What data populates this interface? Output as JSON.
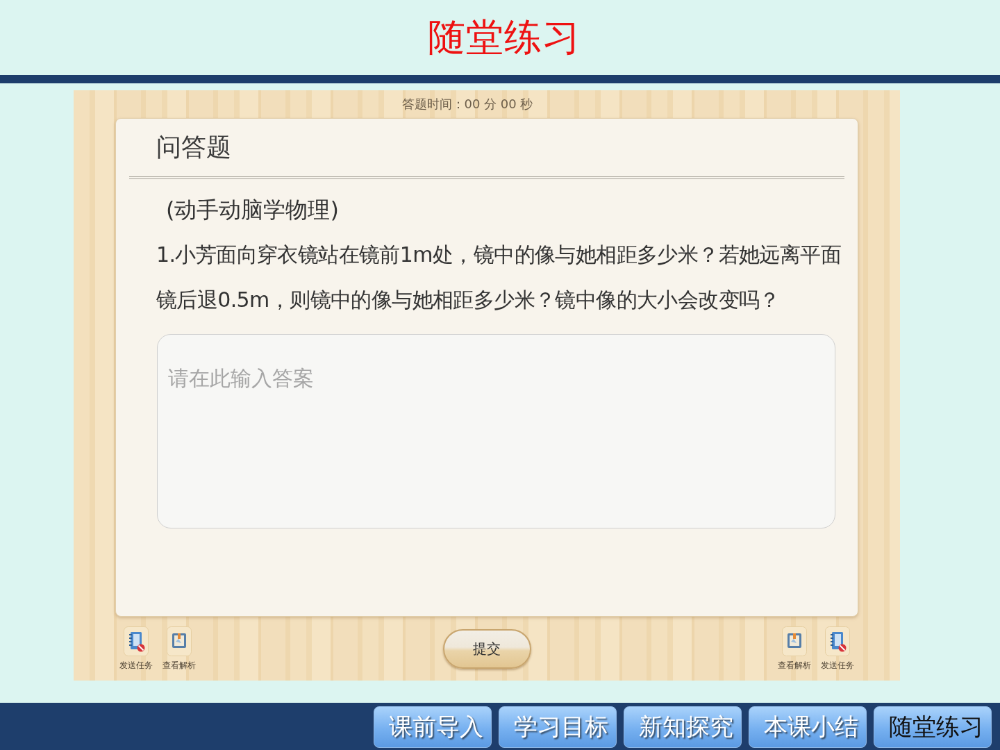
{
  "slide": {
    "title": "随堂练习"
  },
  "quiz": {
    "timer": "答题时间：00 分 00 秒",
    "card": {
      "heading": "问答题",
      "source": "(动手动脑学物理)",
      "question": "1.小芳面向穿衣镜站在镜前1m处，镜中的像与她相距多少米？若她远离平面镜后退0.5m，则镜中的像与她相距多少米？镜中像的大小会改变吗？",
      "answer_field": {
        "placeholder": "请在此输入答案"
      }
    },
    "left_tools": [
      {
        "kind": "send",
        "label": "发送任务"
      },
      {
        "kind": "analysis",
        "label": "查看解析"
      }
    ],
    "submit_button": "提交",
    "right_tools": [
      {
        "kind": "analysis",
        "label": "查看解析"
      },
      {
        "kind": "send",
        "label": "发送任务"
      }
    ]
  },
  "nav_tabs": [
    {
      "label": "课前导入",
      "selected": false
    },
    {
      "label": "学习目标",
      "selected": false
    },
    {
      "label": "新知探究",
      "selected": false
    },
    {
      "label": "本课小结",
      "selected": false
    },
    {
      "label": "随堂练习",
      "selected": true
    }
  ]
}
